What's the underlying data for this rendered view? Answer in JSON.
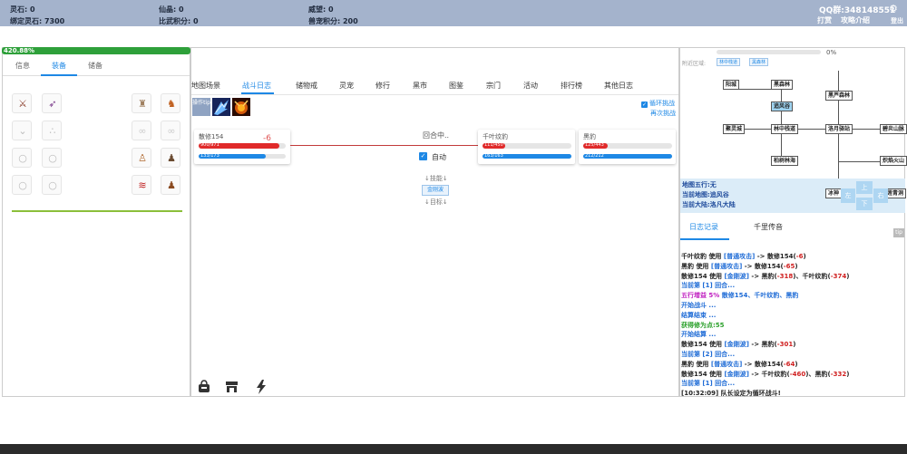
{
  "topbar": {
    "lingshi": "灵石: 0",
    "bound_lingshi": "绑定灵石: 7300",
    "xianjing": "仙晶: 0",
    "biwu": "比武积分: 0",
    "weiwang": "威望: 0",
    "shouchong": "兽宠积分: 200",
    "qq": "QQ群:348148551",
    "reward": "打赏",
    "guide": "攻略介绍",
    "logout": "登出"
  },
  "left": {
    "xp_text": "420.88%",
    "tabs": [
      "信息",
      "装备",
      "储备"
    ],
    "active_tab": "装备"
  },
  "center": {
    "tabs": [
      "地图场景",
      "战斗日志",
      "储物戒",
      "灵宠",
      "修行",
      "黑市",
      "图鉴",
      "宗门",
      "活动",
      "排行榜",
      "其他日志"
    ],
    "active_tab": "战斗日志",
    "op_tip": "操作tip",
    "cycle_label": "循环挑战",
    "again_label": "再次挑战",
    "round_text": "回合中..",
    "auto_label": "自动",
    "skill_label": "↓技能↓",
    "skill_button": "金刚波",
    "target_label": "↓目标↓",
    "damage_float": "-6",
    "player": {
      "name": "散修154",
      "hp": "900/971",
      "mp": "133/173",
      "hp_ratio": 0.93,
      "mp_ratio": 0.77
    },
    "enemies": [
      {
        "name": "千叶纹豹",
        "hp": "111/450",
        "mp": "163/163",
        "hp_ratio": 0.25,
        "mp_ratio": 1.0
      },
      {
        "name": "黑豹",
        "hp": "125/443",
        "mp": "212/212",
        "hp_ratio": 0.28,
        "mp_ratio": 1.0
      }
    ]
  },
  "right": {
    "progress_pct": "0%",
    "area_label": "附近区域:",
    "area_tags": [
      "林中栈道",
      "黑森林"
    ],
    "map_nodes": [
      "阳城",
      "黑森林",
      "追风谷",
      "黑芦森林",
      "聚灵城",
      "林中栈道",
      "洛月驿站",
      "碧炎山脉",
      "柏树林海",
      "炽焰火山",
      "冰神",
      "莲青洞"
    ],
    "current_node": "追风谷",
    "element": "地图五行:无",
    "current_map": "当前地图:追风谷",
    "current_continent": "当前大陆:洛凡大陆",
    "dpad": {
      "up": "上",
      "down": "下",
      "left": "左",
      "right": "右"
    },
    "tabs": [
      "日志记录",
      "千里传音"
    ],
    "active_tab": "日志记录",
    "tip": "tip",
    "log_lines": [
      [
        {
          "t": "千叶纹豹 ",
          "c": "n"
        },
        {
          "t": "使用 ",
          "c": "n"
        },
        {
          "t": "[普通攻击]",
          "c": "b"
        },
        {
          "t": " -> 散修154(",
          "c": "n"
        },
        {
          "t": "-6",
          "c": "r"
        },
        {
          "t": ")",
          "c": "n"
        }
      ],
      [
        {
          "t": "黑豹 ",
          "c": "n"
        },
        {
          "t": "使用 ",
          "c": "n"
        },
        {
          "t": "[普通攻击]",
          "c": "b"
        },
        {
          "t": " -> 散修154(",
          "c": "n"
        },
        {
          "t": "-65",
          "c": "r"
        },
        {
          "t": ")",
          "c": "n"
        }
      ],
      [
        {
          "t": "散修154 ",
          "c": "n"
        },
        {
          "t": "使用 ",
          "c": "n"
        },
        {
          "t": "[金刚波]",
          "c": "b"
        },
        {
          "t": " -> 黑豹(",
          "c": "n"
        },
        {
          "t": "-318",
          "c": "r"
        },
        {
          "t": ")、千叶纹豹(",
          "c": "n"
        },
        {
          "t": "-374",
          "c": "r"
        },
        {
          "t": ")",
          "c": "n"
        }
      ],
      [
        {
          "t": "当前第 [1] 回合...",
          "c": "b"
        }
      ],
      [
        {
          "t": "五行增益 5% ",
          "c": "p"
        },
        {
          "t": "散修154、千叶纹豹、黑豹",
          "c": "b"
        }
      ],
      [
        {
          "t": "开始战斗 ...",
          "c": "b"
        }
      ],
      [
        {
          "t": "结算结束 ...",
          "c": "b"
        }
      ],
      [
        {
          "t": "获得修为点:55",
          "c": "g"
        }
      ],
      [
        {
          "t": "开始结算 ...",
          "c": "b"
        }
      ],
      [
        {
          "t": "散修154 ",
          "c": "n"
        },
        {
          "t": "使用 ",
          "c": "n"
        },
        {
          "t": "[金刚波]",
          "c": "b"
        },
        {
          "t": " -> 黑豹(",
          "c": "n"
        },
        {
          "t": "-301",
          "c": "r"
        },
        {
          "t": ")",
          "c": "n"
        }
      ],
      [
        {
          "t": "当前第 [2] 回合...",
          "c": "b"
        }
      ],
      [
        {
          "t": "黑豹 ",
          "c": "n"
        },
        {
          "t": "使用 ",
          "c": "n"
        },
        {
          "t": "[普通攻击]",
          "c": "b"
        },
        {
          "t": " -> 散修154(",
          "c": "n"
        },
        {
          "t": "-64",
          "c": "r"
        },
        {
          "t": ")",
          "c": "n"
        }
      ],
      [
        {
          "t": "散修154 ",
          "c": "n"
        },
        {
          "t": "使用 ",
          "c": "n"
        },
        {
          "t": "[金刚波]",
          "c": "b"
        },
        {
          "t": " -> 千叶纹豹(",
          "c": "n"
        },
        {
          "t": "-460",
          "c": "r"
        },
        {
          "t": ")、黑豹(",
          "c": "n"
        },
        {
          "t": "-332",
          "c": "r"
        },
        {
          "t": ")",
          "c": "n"
        }
      ],
      [
        {
          "t": "当前第 [1] 回合...",
          "c": "b"
        }
      ],
      [
        {
          "t": "[10:32:09] 队长设定为循环战斗!",
          "c": "n"
        }
      ]
    ]
  },
  "icons": {
    "equip_slots": [
      "sword-icon",
      "bow-icon",
      "necklace-icon",
      "earring-icon",
      "ring-icon",
      "ring-icon",
      "ring-icon",
      "ring-icon",
      "helmet-icon",
      "armor-icon",
      "belt-icon",
      "bracer-icon",
      "robe-icon",
      "boots-icon",
      "sash-icon",
      "shoes-icon"
    ],
    "bottom": [
      "bag-icon",
      "shop-icon",
      "lightning-icon"
    ]
  }
}
